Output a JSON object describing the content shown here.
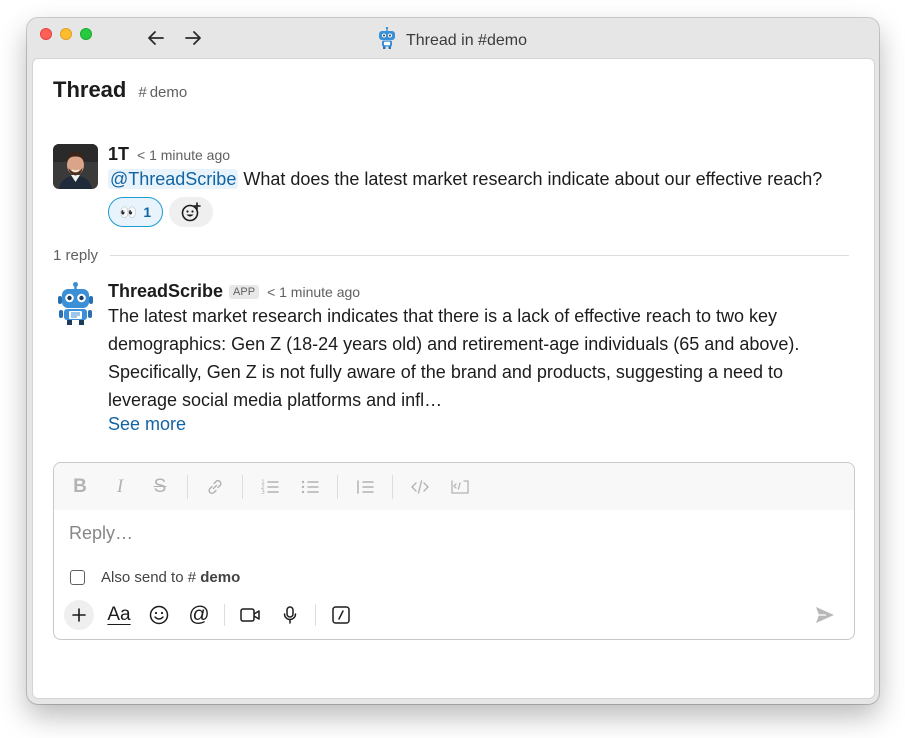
{
  "window": {
    "title": "Thread in #demo"
  },
  "header": {
    "title": "Thread",
    "channel": "demo"
  },
  "messages": [
    {
      "author": "1T",
      "time": "< 1 minute ago",
      "mention": "@ThreadScribe",
      "text": " What does the latest market research indicate about our effective reach?",
      "reactions": [
        {
          "emoji": "👀",
          "count": "1"
        }
      ]
    },
    {
      "author": "ThreadScribe",
      "badge": "APP",
      "time": "< 1 minute ago",
      "text": "The latest market research indicates that there is a lack of effective reach to two key demographics: Gen Z (18-24 years old) and retirement-age individuals (65 and above). Specifically, Gen Z is not fully aware of the brand and products, suggesting a need to leverage social media platforms and infl…",
      "see_more": "See more"
    }
  ],
  "reply_count": "1 reply",
  "composer": {
    "placeholder": "Reply…",
    "also_send_label": "Also send to",
    "also_send_channel": "demo",
    "formatting": [
      "bold",
      "italic",
      "strikethrough",
      "link",
      "ordered-list",
      "bulleted-list",
      "blockquote",
      "code",
      "code-block"
    ],
    "colors": {
      "accent": "#1264a3",
      "mention_bg": "#e8f3fb",
      "reaction_border": "#1d9bd1"
    }
  }
}
